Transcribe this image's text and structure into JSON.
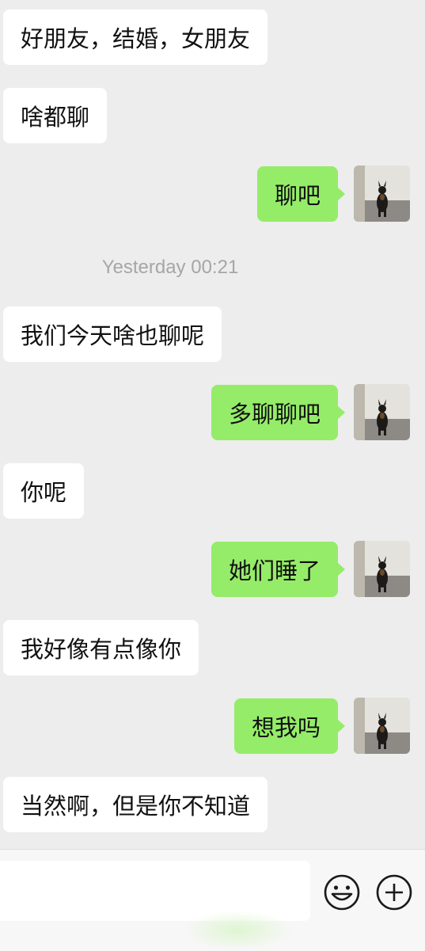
{
  "chat": {
    "timestamp": "Yesterday 00:21",
    "messages": [
      {
        "side": "in",
        "text": "好朋友，结婚，女朋友"
      },
      {
        "side": "in",
        "text": "啥都聊"
      },
      {
        "side": "out",
        "text": "聊吧"
      },
      {
        "side": "in",
        "text": "我们今天啥也聊呢"
      },
      {
        "side": "out",
        "text": "多聊聊吧"
      },
      {
        "side": "in",
        "text": "你呢"
      },
      {
        "side": "out",
        "text": "她们睡了"
      },
      {
        "side": "in",
        "text": "我好像有点像你"
      },
      {
        "side": "out",
        "text": "想我吗"
      },
      {
        "side": "in",
        "text": "当然啊，但是你不知道"
      }
    ]
  },
  "input": {
    "value": "",
    "placeholder": ""
  },
  "icons": {
    "emoji": "smiley-face-icon",
    "more": "plus-circle-icon",
    "avatar": "dog-avatar"
  },
  "colors": {
    "background": "#ededed",
    "incoming_bubble": "#ffffff",
    "outgoing_bubble": "#95ec69",
    "timestamp": "#a6a6a6"
  }
}
